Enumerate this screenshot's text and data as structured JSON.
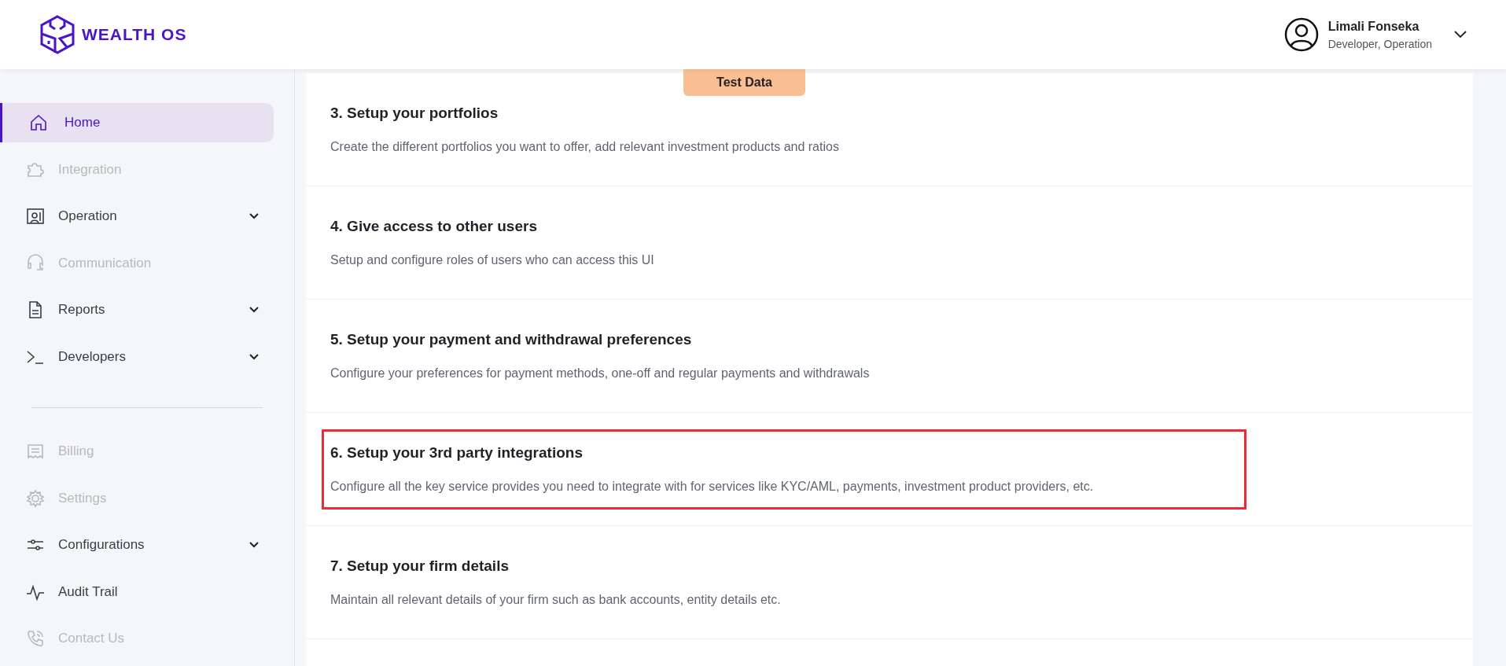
{
  "brand": {
    "name": "WEALTH OS"
  },
  "user": {
    "name": "Limali Fonseka",
    "roles": "Developer, Operation"
  },
  "badge": "Test Data",
  "sidebar": {
    "items": [
      {
        "label": "Home",
        "selected": true,
        "disabled": false,
        "expandable": false
      },
      {
        "label": "Integration",
        "selected": false,
        "disabled": true,
        "expandable": false
      },
      {
        "label": "Operation",
        "selected": false,
        "disabled": false,
        "expandable": true
      },
      {
        "label": "Communication",
        "selected": false,
        "disabled": true,
        "expandable": false
      },
      {
        "label": "Reports",
        "selected": false,
        "disabled": false,
        "expandable": true
      },
      {
        "label": "Developers",
        "selected": false,
        "disabled": false,
        "expandable": true
      },
      {
        "kind": "divider"
      },
      {
        "label": "Billing",
        "selected": false,
        "disabled": true,
        "expandable": false
      },
      {
        "label": "Settings",
        "selected": false,
        "disabled": true,
        "expandable": false
      },
      {
        "label": "Configurations",
        "selected": false,
        "disabled": false,
        "expandable": true
      },
      {
        "label": "Audit Trail",
        "selected": false,
        "disabled": false,
        "expandable": false
      },
      {
        "label": "Contact Us",
        "selected": false,
        "disabled": true,
        "expandable": false
      }
    ]
  },
  "steps": [
    {
      "title": "3. Setup your portfolios",
      "description": "Create the different portfolios you want to offer, add relevant investment products and ratios",
      "highlighted": false
    },
    {
      "title": "4. Give access to other users",
      "description": "Setup and configure roles of users who can access this UI",
      "highlighted": false
    },
    {
      "title": "5. Setup your payment and withdrawal preferences",
      "description": "Configure your preferences for payment methods, one-off and regular payments and withdrawals",
      "highlighted": false
    },
    {
      "title": "6. Setup your 3rd party integrations",
      "description": "Configure all the key service provides you need to integrate with for services like KYC/AML, payments, investment product providers, etc.",
      "highlighted": true
    },
    {
      "title": "7. Setup your firm details",
      "description": "Maintain all relevant details of your firm such as bank accounts, entity details etc.",
      "highlighted": false
    }
  ]
}
